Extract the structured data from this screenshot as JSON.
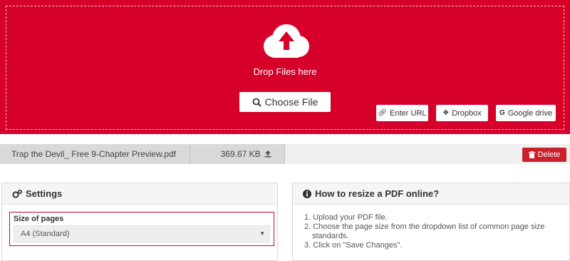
{
  "upload": {
    "drop_text": "Drop Files here",
    "choose_label": "Choose File",
    "sources": [
      {
        "label": "Enter URL",
        "icon": "link-icon"
      },
      {
        "label": "Dropbox",
        "icon": "dropbox-icon"
      },
      {
        "label": "Google drive",
        "icon": "google-icon"
      }
    ]
  },
  "file": {
    "name": "Trap the Devil_ Free 9-Chapter Preview.pdf",
    "size": "369.67 KB",
    "delete_label": "Delete"
  },
  "settings": {
    "title": "Settings",
    "size_label": "Size of pages",
    "size_value": "A4 (Standard)"
  },
  "howto": {
    "title": "How to resize a PDF online?",
    "step1": "1. Upload your PDF file.",
    "step2a": "2. Choose the page size from the dropdown list of common page size",
    "step2b": "standards.",
    "step3": "3. Click on \"Save Changes\"."
  },
  "colors": {
    "brand_red": "#d6002a",
    "delete_red": "#c9202c"
  }
}
